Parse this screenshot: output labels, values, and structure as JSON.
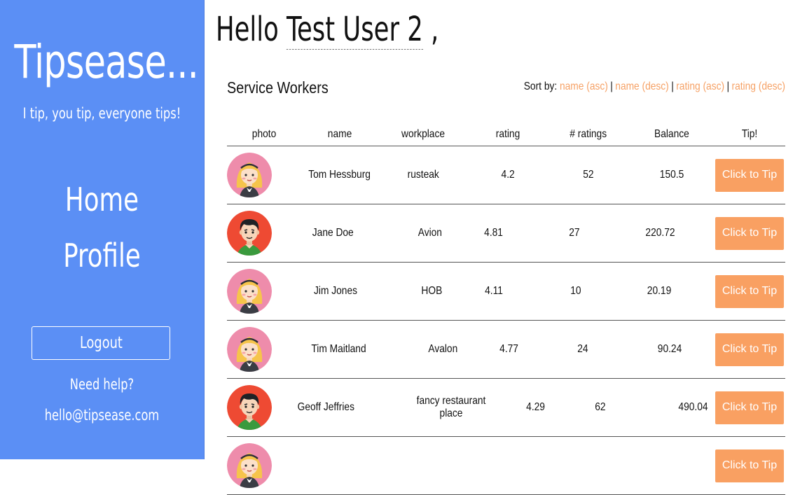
{
  "sidebar": {
    "brand": "Tipsease...",
    "tagline": "I tip, you tip, everyone tips!",
    "nav": {
      "home": "Home",
      "profile": "Profile"
    },
    "logout_label": "Logout",
    "help_text": "Need help?",
    "email": "hello@tipsease.com"
  },
  "header": {
    "greeting_prefix": "Hello ",
    "user_name": "Test User 2",
    "greeting_suffix": " ,"
  },
  "workers": {
    "title": "Service Workers",
    "sort_label": "Sort by:",
    "sort_options": [
      "name (asc)",
      "name (desc)",
      "rating (asc)",
      "rating (desc)"
    ],
    "separator": "|",
    "columns": [
      "photo",
      "name",
      "workplace",
      "rating",
      "# ratings",
      "Balance",
      "Tip!"
    ],
    "tip_label": "Click to Tip",
    "rows": [
      {
        "name": "Tom Hessburg",
        "workplace": "rusteak",
        "rating": "4.2",
        "num_ratings": "52",
        "balance": "150.5",
        "avatar": "female-avatar"
      },
      {
        "name": "Jane Doe",
        "workplace": "Avion",
        "rating": "4.81",
        "num_ratings": "27",
        "balance": "220.72",
        "avatar": "male-avatar"
      },
      {
        "name": "Jim Jones",
        "workplace": "HOB",
        "rating": "4.11",
        "num_ratings": "10",
        "balance": "20.19",
        "avatar": "female-avatar"
      },
      {
        "name": "Tim Maitland",
        "workplace": "Avalon",
        "rating": "4.77",
        "num_ratings": "24",
        "balance": "90.24",
        "avatar": "female-avatar"
      },
      {
        "name": "Geoff Jeffries",
        "workplace": "fancy restaurant place",
        "rating": "4.29",
        "num_ratings": "62",
        "balance": "490.04",
        "avatar": "male-avatar"
      },
      {
        "name": "",
        "workplace": "",
        "rating": "",
        "num_ratings": "",
        "balance": "",
        "avatar": "female-avatar"
      }
    ]
  },
  "colors": {
    "sidebar_bg": "#5b8ff5",
    "accent": "#f9a062",
    "female_avatar_bg": "#ee8cab",
    "male_avatar_bg": "#ee4a33"
  }
}
